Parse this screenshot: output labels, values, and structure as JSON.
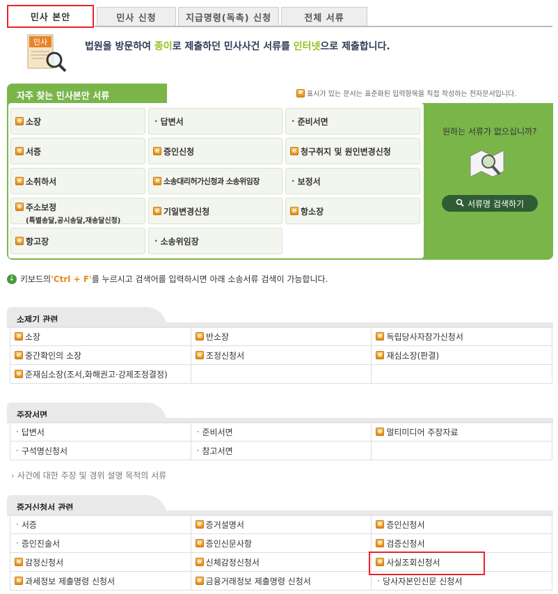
{
  "tabs": [
    {
      "label": "민사 본안",
      "active": true
    },
    {
      "label": "민사 신청"
    },
    {
      "label": "지급명령(독촉) 신청"
    },
    {
      "label": "전체 서류"
    }
  ],
  "intro": {
    "icon_label": "민사",
    "part1": "법원을 방문하여 ",
    "hl1": "종이",
    "part2": "로 제출하던 민사사건 서류를 ",
    "hl2": "인터넷",
    "part3": "으로 제출합니다."
  },
  "frequent": {
    "title": "자주 찾는 민사본안 서류",
    "note": "표시가 있는 문서는 표준화된 입력항목을 직접 작성하는 전자문서입니다.",
    "items": [
      {
        "label": "소장",
        "e": true
      },
      {
        "label": "답변서",
        "e": false
      },
      {
        "label": "준비서면",
        "e": false
      },
      {
        "label": "서증",
        "e": true
      },
      {
        "label": "증인신청",
        "e": true
      },
      {
        "label": "청구취지 및 원인변경신청",
        "e": true
      },
      {
        "label": "소취하서",
        "e": true
      },
      {
        "label": "소송대리허가신청과 소송위임장",
        "e": true
      },
      {
        "label": "보정서",
        "e": false
      },
      {
        "label": "주소보정",
        "sub": "(특별송달,공시송달,재송달신청)",
        "e": true
      },
      {
        "label": "기일변경신청",
        "e": true
      },
      {
        "label": "항소장",
        "e": true
      },
      {
        "label": "항고장",
        "e": true
      },
      {
        "label": "소송위임장",
        "e": false
      }
    ],
    "side_question": "원하는 서류가 없으십니까?",
    "search_button": "서류명 검색하기"
  },
  "keyboard": {
    "part1": "키보드의 ",
    "keys": "'Ctrl + F'",
    "part2": "를 누르시고 검색어를 입력하시면 아래 소송서류 검색이 가능합니다."
  },
  "sections": [
    {
      "title": "소제기 관련",
      "rows": [
        [
          {
            "label": "소장",
            "e": true
          },
          {
            "label": "반소장",
            "e": true
          },
          {
            "label": "독립당사자참가신청서",
            "e": true
          }
        ],
        [
          {
            "label": "중간확인의 소장",
            "e": true
          },
          {
            "label": "조정신청서",
            "e": true
          },
          {
            "label": "재심소장(판결)",
            "e": true
          }
        ],
        [
          {
            "label": "준재심소장(조서,화해권고·강제조정결정)",
            "e": true
          },
          {
            "label": ""
          },
          {
            "label": ""
          }
        ]
      ]
    },
    {
      "title": "주장서면",
      "rows": [
        [
          {
            "label": "답변서",
            "e": false
          },
          {
            "label": "준비서면",
            "e": false
          },
          {
            "label": "멀티미디어 주장자료",
            "e": true
          }
        ],
        [
          {
            "label": "구석명신청서",
            "e": false
          },
          {
            "label": "참고서면",
            "e": false
          },
          {
            "label": ""
          }
        ]
      ],
      "note": "사건에 대한 주장 및 경위 설명 목적의 서류"
    },
    {
      "title": "증거신청서 관련",
      "rows": [
        [
          {
            "label": "서증",
            "e": false
          },
          {
            "label": "증거설명서",
            "e": true
          },
          {
            "label": "증인신청서",
            "e": true
          }
        ],
        [
          {
            "label": "증인진술서",
            "e": false
          },
          {
            "label": "증인신문사항",
            "e": true
          },
          {
            "label": "검증신청서",
            "e": true
          }
        ],
        [
          {
            "label": "감정신청서",
            "e": true
          },
          {
            "label": "신체감정신청서",
            "e": true
          },
          {
            "label": "사실조회신청서",
            "e": true
          }
        ],
        [
          {
            "label": "과세정보 제출명령 신청서",
            "e": true
          },
          {
            "label": "금융거래정보 제출명령 신청서",
            "e": true
          },
          {
            "label": "당사자본인신문 신청서",
            "e": false
          }
        ]
      ]
    }
  ],
  "colors": {
    "accent_green": "#7ab54a",
    "highlight_red": "#e8222a",
    "search_btn": "#2f5c35"
  }
}
